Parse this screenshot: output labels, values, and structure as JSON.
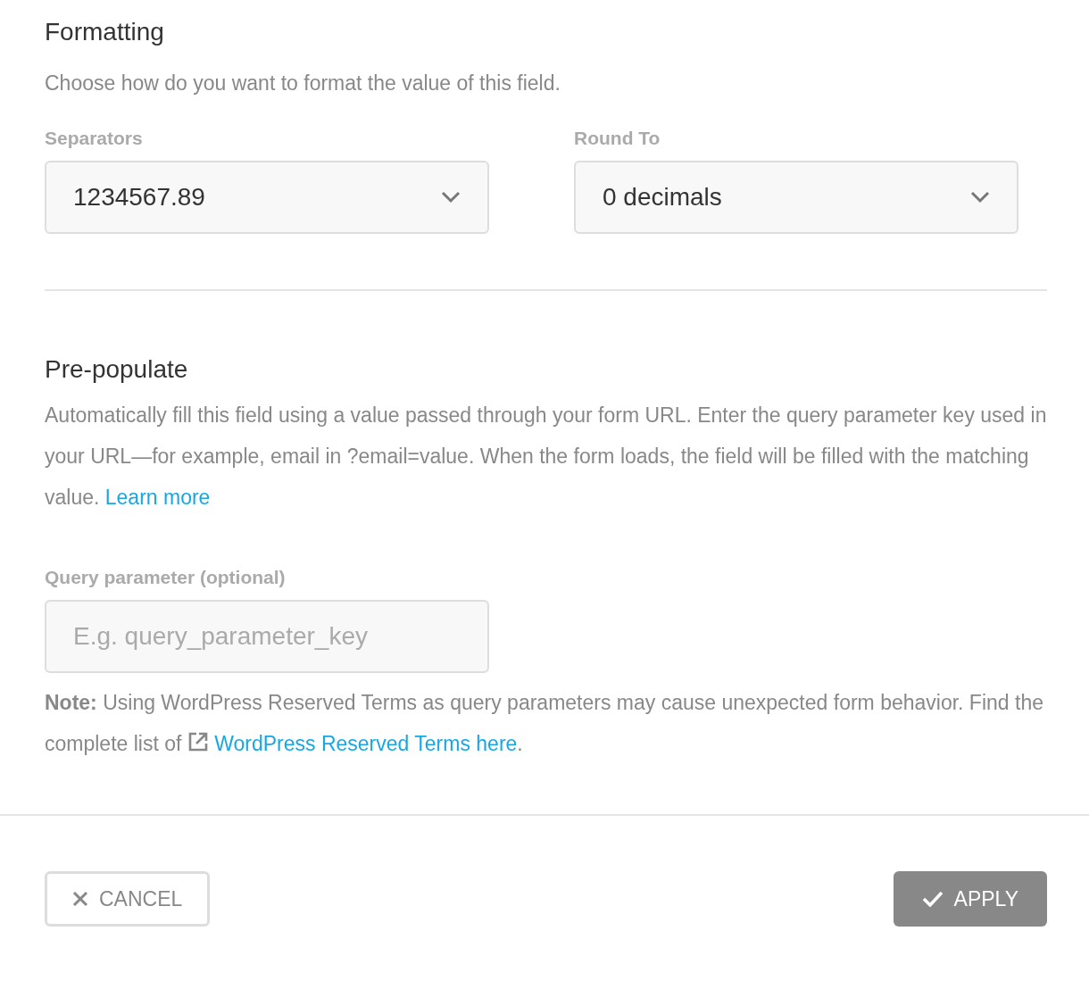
{
  "formatting": {
    "title": "Formatting",
    "description": "Choose how do you want to format the value of this field.",
    "fields": [
      {
        "label": "Separators",
        "value": "1234567.89"
      },
      {
        "label": "Round To",
        "value": "0 decimals"
      }
    ]
  },
  "prepopulate": {
    "title": "Pre-populate",
    "description": "Automatically fill this field using a value passed through your form URL. Enter the query parameter key used in your URL—for example, email in ?email=value. When the form loads, the field will be filled with the matching value. ",
    "link": "Learn more",
    "field": {
      "label": "Query parameter (optional)",
      "placeholder": "E.g. query_parameter_key"
    },
    "note": "**Note:** Using WordPress Reserved Terms as query parameters may cause unexpected form behavior. Find the complete list of ",
    "note_link": "WordPress Reserved Terms here",
    "note_end": "."
  },
  "buttons": [
    {
      "kind": "cancel",
      "label": "CANCEL"
    },
    {
      "kind": "apply",
      "label": "APPLY",
      "disabled": true
    }
  ]
}
